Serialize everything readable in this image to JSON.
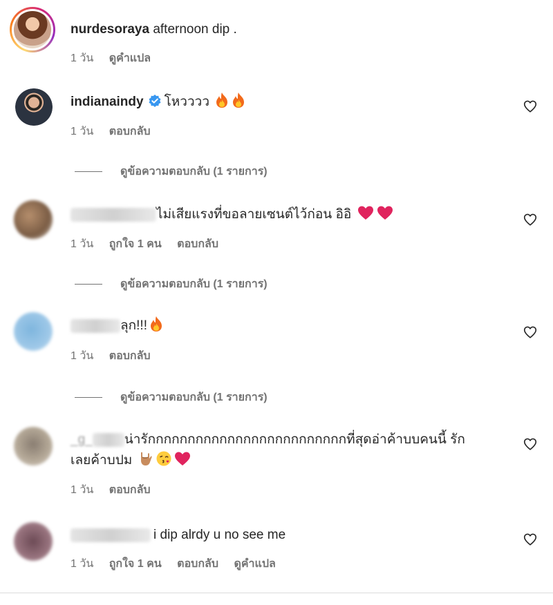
{
  "comments": [
    {
      "username": "nurdesoraya",
      "text": "afternoon dip .",
      "meta": {
        "time": "1 วัน",
        "translate": "ดูคำแปล"
      }
    },
    {
      "username": "indianaindy",
      "verified": true,
      "text": "โหวววว",
      "emojis": [
        "fire",
        "fire"
      ],
      "meta": {
        "time": "1 วัน",
        "reply": "ตอบกลับ"
      },
      "view_replies": "ดูข้อความตอบกลับ (1 รายการ)"
    },
    {
      "username_hidden": true,
      "text": "ไม่เสียแรงที่ขอลายเซนต์ไว้ก่อน อิอิ",
      "emojis": [
        "red-heart",
        "red-heart"
      ],
      "meta": {
        "time": "1 วัน",
        "likes": "ถูกใจ 1 คน",
        "reply": "ตอบกลับ"
      },
      "view_replies": "ดูข้อความตอบกลับ (1 รายการ)"
    },
    {
      "username_hidden": true,
      "text": "ลุก!!!",
      "emojis": [
        "fire"
      ],
      "meta": {
        "time": "1 วัน",
        "reply": "ตอบกลับ"
      },
      "view_replies": "ดูข้อความตอบกลับ (1 รายการ)"
    },
    {
      "username_hidden": true,
      "username_partial": "_g_",
      "text": "น่ารักกกกกกกกกกกกกกกกกกกกกกกกกที่สุดอ่าค้าบบคนนี้ รัก",
      "text_line2": "เลยค้าบปม",
      "emojis": [
        "love-you-gesture",
        "face-blowing-kiss",
        "red-heart"
      ],
      "meta": {
        "time": "1 วัน",
        "reply": "ตอบกลับ"
      }
    },
    {
      "username_hidden": true,
      "text": "i dip alrdy u no see me",
      "meta": {
        "time": "1 วัน",
        "likes": "ถูกใจ 1 คน",
        "reply": "ตอบกลับ",
        "translate": "ดูคำแปล"
      }
    }
  ],
  "colors": {
    "text": "#262626",
    "secondary": "#737373",
    "verified": "#3897f0",
    "heart_red": "#e0245e",
    "fire": "#f26a1b"
  }
}
